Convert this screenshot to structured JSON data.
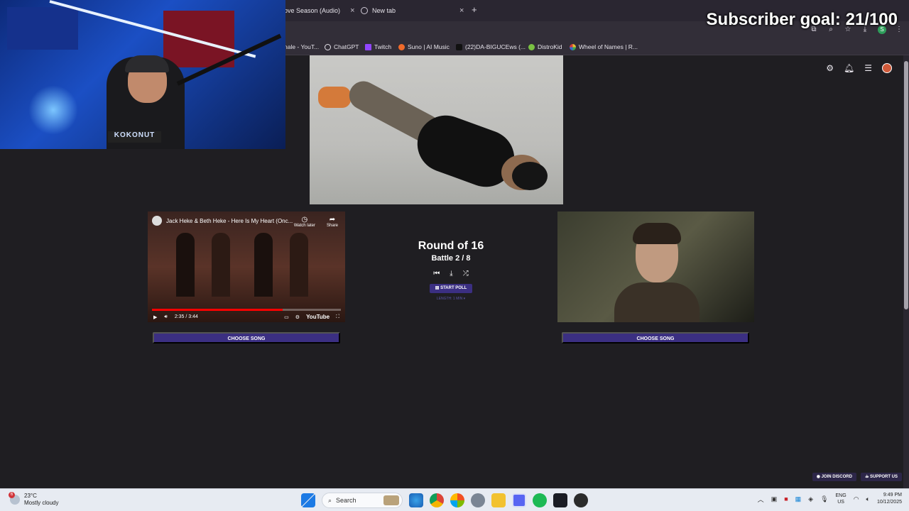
{
  "browser": {
    "tabs": [
      {
        "label": "ove Season (Audio)",
        "close": "×"
      },
      {
        "label": "New tab",
        "close": "×"
      }
    ],
    "new_tab_symbol": "+",
    "bookmarks": [
      {
        "label": "nale - YouT...",
        "icon": "youtube-icon",
        "color": "#ff0000"
      },
      {
        "label": "ChatGPT",
        "icon": "chatgpt-icon",
        "color": "#e6e3ea"
      },
      {
        "label": "Twitch",
        "icon": "twitch-icon",
        "color": "#9146ff"
      },
      {
        "label": "Suno | AI Music",
        "icon": "suno-icon",
        "color": "#f06a2a"
      },
      {
        "label": "(22)DA-BIGUCEws (...",
        "icon": "tiktok-icon",
        "color": "#111111"
      },
      {
        "label": "DistroKid",
        "icon": "distrokid-icon",
        "color": "#7ac142"
      },
      {
        "label": "Wheel of Names | R...",
        "icon": "wheel-icon",
        "color": "#e8b931"
      }
    ]
  },
  "overlay": {
    "subscriber_goal": "Subscriber goal: 21/100"
  },
  "battle": {
    "round_title": "Round of 16",
    "battle_label": "Battle 2 / 8",
    "start_poll_label": "START POLL",
    "length_note": "LENGTH: 1 MIN ▾",
    "left": {
      "video_title": "Jack Heke & Beth Heke - Here Is My Heart (Onc...",
      "watch_later": "Watch later",
      "share": "Share",
      "time": "2:35 / 3:44",
      "progress": 0.69,
      "youtube_logo": "YouTube",
      "choose_label": "CHOOSE SONG"
    },
    "right": {
      "choose_label": "CHOOSE SONG"
    }
  },
  "footer_links": {
    "discord": "JOIN DISCORD",
    "support": "SUPPORT US"
  },
  "taskbar": {
    "weather_temp": "23°C",
    "weather_desc": "Mostly cloudy",
    "weather_badge": "6",
    "search_placeholder": "Search",
    "lang_line1": "ENG",
    "lang_line2": "US",
    "time": "9:49 PM",
    "date": "10/12/2025"
  },
  "colors": {
    "accent": "#3b2f82",
    "background": "#1f1e22",
    "progress_red": "#ff0000"
  }
}
